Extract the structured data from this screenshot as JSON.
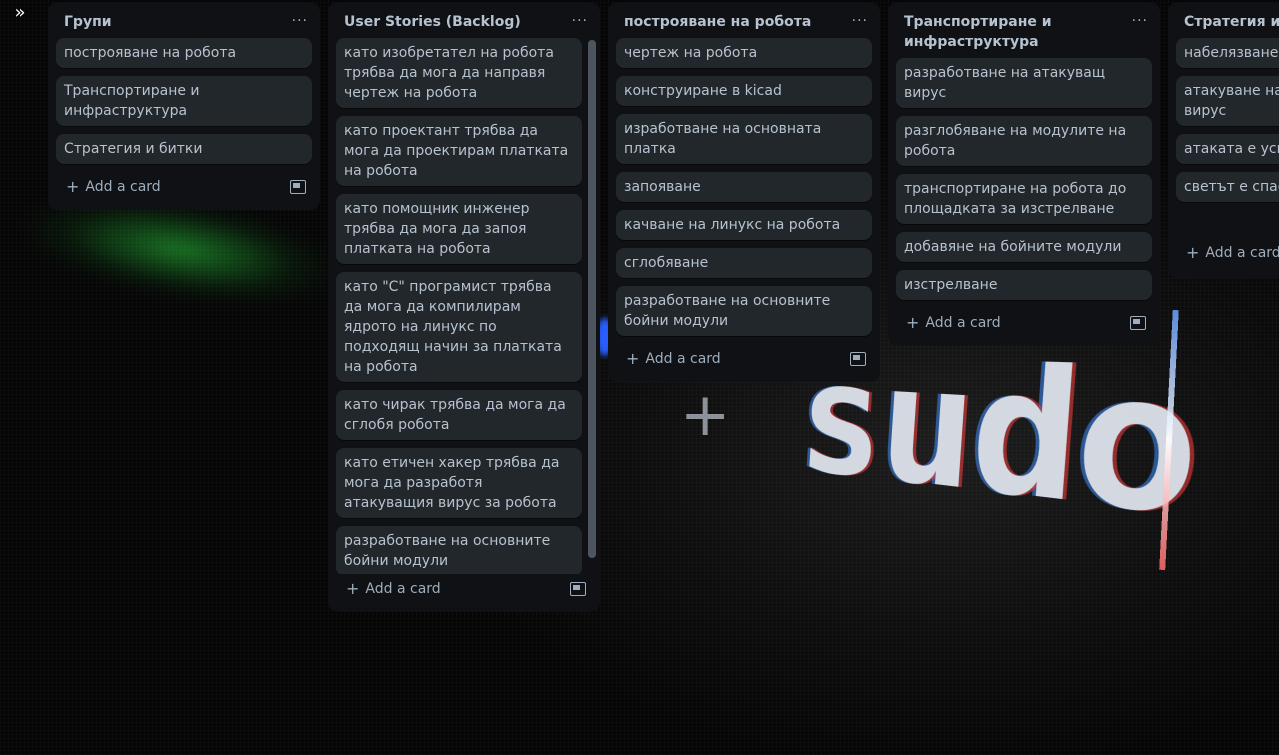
{
  "expand_icon": "chevrons-right-icon",
  "board": {
    "lists": [
      {
        "title": "Групи",
        "menu": "···",
        "cards": [
          "построяване на робота",
          "Транспортиране и инфраструктура",
          "Стратегия и битки"
        ],
        "add_label": "Add a card"
      },
      {
        "title": "User Stories (Backlog)",
        "menu": "···",
        "cards": [
          "като изобретател на робота трябва да мога да направя чертеж на робота",
          "като проектант трябва да мога да проектирам платката на робота",
          "като помощник инженер трябва да мога да запоя платката на робота",
          "като \"C\" програмист трябва да мога да компилирам ядрото на линукс по подходящ начин за платката на робота",
          "като чирак трябва да мога да сглобя робота",
          "като етичен хакер трябва да мога да разработя атакуващия вирус за робота",
          "разработване на основните бойни модули"
        ],
        "add_label": "Add a card"
      },
      {
        "title": "построяване на робота",
        "menu": "···",
        "cards": [
          "чертеж на робота",
          "конструиране в kicad",
          "изработване на основната платка",
          "запояване",
          "качване на линукс на робота",
          "сглобяване",
          "разработване на основните бойни модули"
        ],
        "add_label": "Add a card"
      },
      {
        "title": "Транспортиране и инфраструктура",
        "menu": "···",
        "cards": [
          "разработване на атакуващ вирус",
          "разглобяване на модулите на робота",
          "транспортиране на робота до площадката за изстрелване",
          "добавяне на бойните модули",
          "изстрелване"
        ],
        "add_label": "Add a card"
      },
      {
        "title": "Стратегия и битки",
        "menu": "···",
        "cards": [
          "набелязване на извънземни",
          "атакуване на им хардуер с вирус",
          "атаката е успешна",
          "светът е спасен"
        ],
        "add_label": "Add a card"
      }
    ]
  }
}
